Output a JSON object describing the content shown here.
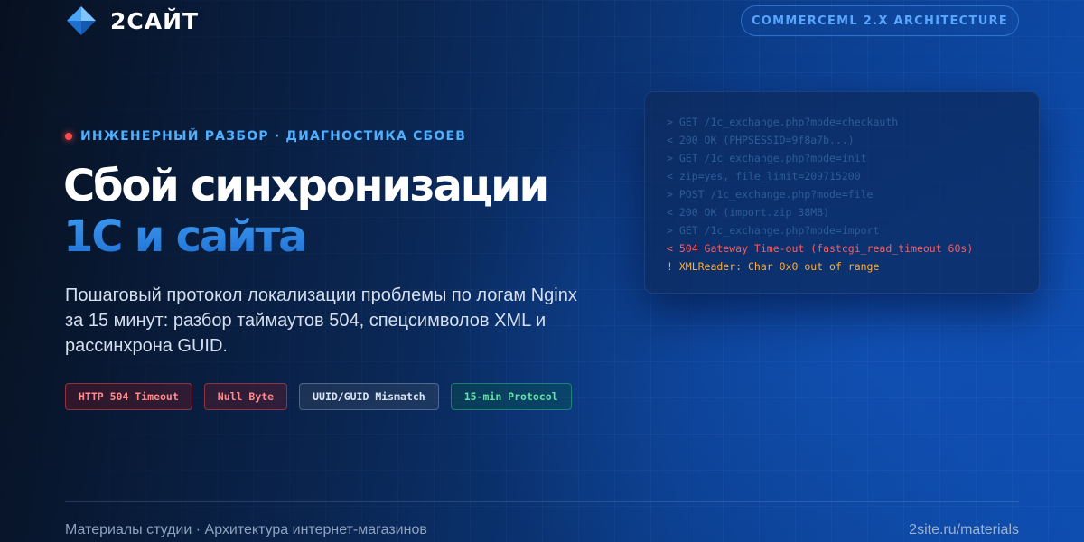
{
  "header": {
    "logo_text": "2САЙТ",
    "logo_icon": "diamond-logo-icon",
    "badge_label": "COMMERCEML 2.X ARCHITECTURE"
  },
  "hero": {
    "eyebrow": "ИНЖЕНЕРНЫЙ РАЗБОР · ДИАГНОСТИКА СБОЕВ",
    "title_line1": "Сбой синхронизации",
    "title_line2": "1С и сайта",
    "subtitle": "Пошаговый протокол локализации проблемы по логам Nginx за 15 минут: разбор таймаутов 504, спецсимволов XML и рассинхрона GUID."
  },
  "tags": [
    {
      "label": "HTTP 504 Timeout",
      "tone": "red"
    },
    {
      "label": "Null Byte",
      "tone": "red"
    },
    {
      "label": "UUID/GUID Mismatch",
      "tone": "slate"
    },
    {
      "label": "15-min Protocol",
      "tone": "green"
    }
  ],
  "console": {
    "lines": [
      "> GET /1c_exchange.php?mode=checkauth",
      "< 200 OK (PHPSESSID=9f8a7b...)",
      "> GET /1c_exchange.php?mode=init",
      "< zip=yes, file_limit=209715200",
      "> POST /1c_exchange.php?mode=file",
      "< 200 OK (import.zip 38MB)",
      "> GET /1c_exchange.php?mode=import",
      "< 504 Gateway Time-out (fastcgi_read_timeout 60s)",
      "! XMLReader: Char 0x0 out of range"
    ]
  },
  "footer": {
    "left_text": "Материалы студии · Архитектура интернет-магазинов",
    "link_text": "2site.ru/materials"
  },
  "colors": {
    "accent": "#4fb0ff",
    "error": "#ff5a5a",
    "warning": "#ffad33",
    "success": "#5fe3a4"
  }
}
